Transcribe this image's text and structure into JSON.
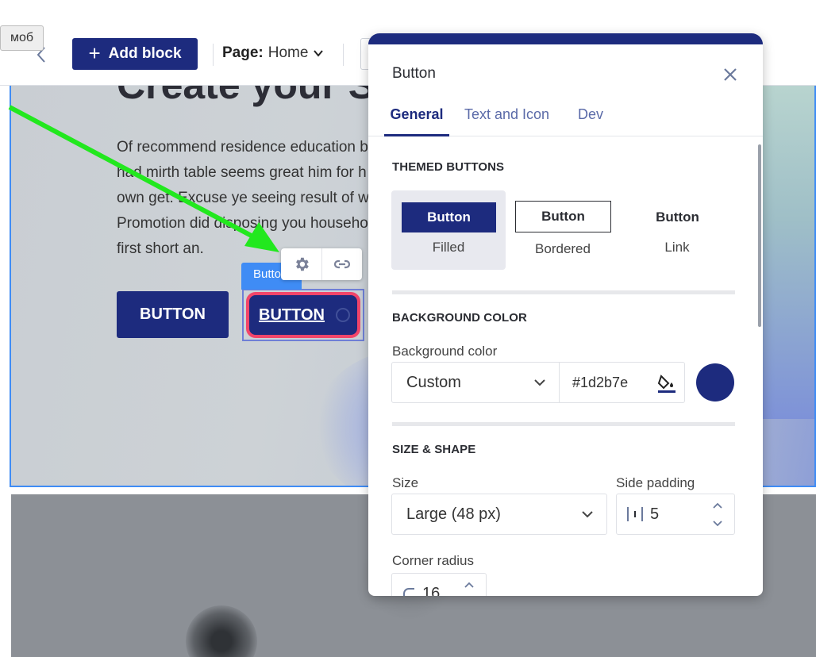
{
  "tooltip": {
    "text": "моб"
  },
  "toolbar": {
    "add_block_label": "Add block",
    "page_label": "Page:",
    "page_value": "Home"
  },
  "hero": {
    "title": "Create your Si",
    "body_lines": [
      "Of recommend residence education b",
      "had mirth table seems great him for h",
      "own get. Excuse ye seeing result of w",
      "Promotion did disposing you househo",
      "first short an."
    ],
    "button_primary": "BUTTON",
    "button_selected": "BUTTON",
    "selected_tag": "Button"
  },
  "panel": {
    "title": "Button",
    "tabs": [
      "General",
      "Text and Icon",
      "Dev"
    ],
    "active_tab": "General",
    "themed": {
      "heading": "THEMED BUTTONS",
      "options": [
        {
          "button": "Button",
          "label": "Filled"
        },
        {
          "button": "Button",
          "label": "Bordered"
        },
        {
          "button": "Button",
          "label": "Link"
        }
      ]
    },
    "background": {
      "heading": "BACKGROUND COLOR",
      "label": "Background color",
      "mode": "Custom",
      "hex": "#1d2b7e"
    },
    "size_shape": {
      "heading": "SIZE & SHAPE",
      "size_label": "Size",
      "size_value": "Large (48 px)",
      "padding_label": "Side padding",
      "padding_value": "5",
      "radius_label": "Corner radius",
      "radius_value": "16"
    }
  },
  "colors": {
    "brand": "#1d2b7e",
    "selection": "#3f8cf5",
    "highlight": "#f2456a",
    "annotation_arrow": "#22e81e"
  },
  "icons": [
    "chevron-left-icon",
    "plus-icon",
    "chevron-down-icon",
    "gear-icon",
    "link-icon",
    "close-icon",
    "paint-bucket-icon",
    "chevron-down-icon",
    "padding-icon",
    "stepper-arrows-icon",
    "corner-radius-icon"
  ]
}
